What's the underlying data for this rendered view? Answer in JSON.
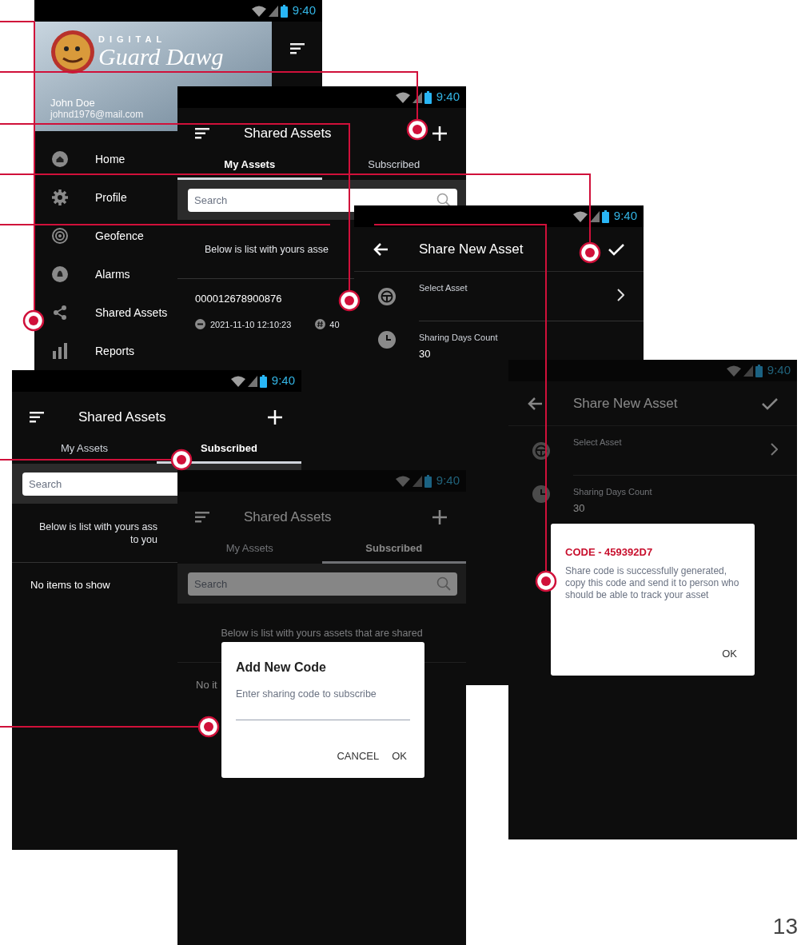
{
  "screens": [
    {
      "kind": "drawer",
      "dimmed": false,
      "time": "9:40",
      "logo_top": "DIGITAL",
      "logo_main": "Guard Dawg",
      "user_name": "John Doe",
      "user_email": "johnd1976@mail.com",
      "menu": [
        {
          "label": "Home"
        },
        {
          "label": "Profile"
        },
        {
          "label": "Geofence"
        },
        {
          "label": "Alarms"
        },
        {
          "label": "Shared Assets"
        },
        {
          "label": "Reports"
        }
      ]
    },
    {
      "kind": "list",
      "dimmed": false,
      "time": "9:40",
      "title": "Shared Assets",
      "tabs": [
        {
          "label": "My Assets",
          "selected": true
        },
        {
          "label": "Subscribed",
          "selected": false
        }
      ],
      "search": {
        "placeholder": "Search"
      },
      "notice_lines": [
        "Below is list with yours asse"
      ],
      "items": [
        {
          "id": "000012678900876",
          "date": "2021-11-10 12:10:23",
          "count": "40"
        }
      ]
    },
    {
      "kind": "form",
      "dimmed": false,
      "time": "9:40",
      "title": "Share New Asset",
      "fields": [
        {
          "label": "Select Asset"
        },
        {
          "label": "Sharing Days Count",
          "value": "30"
        }
      ]
    },
    {
      "kind": "list",
      "dimmed": false,
      "time": "9:40",
      "title": "Shared Assets",
      "tabs": [
        {
          "label": "My Assets",
          "selected": false
        },
        {
          "label": "Subscribed",
          "selected": true
        }
      ],
      "search": {
        "placeholder": "Search"
      },
      "notice_lines": [
        "Below is list with yours ass",
        "to you"
      ],
      "empty": "No items to show"
    },
    {
      "kind": "list",
      "dimmed": true,
      "time": "9:40",
      "title": "Shared Assets",
      "tabs": [
        {
          "label": "My Assets",
          "selected": false
        },
        {
          "label": "Subscribed",
          "selected": true
        }
      ],
      "search": {
        "placeholder": "Search"
      },
      "notice_lines": [
        "Below is list with yours assets that are shared"
      ],
      "empty": "No it",
      "dialog": {
        "kind": "input",
        "title": "Add New Code",
        "placeholder": "Enter sharing code to subscribe",
        "buttons": [
          "CANCEL",
          "OK"
        ]
      }
    },
    {
      "kind": "form",
      "dimmed": true,
      "time": "9:40",
      "title": "Share New Asset",
      "fields": [
        {
          "label": "Select Asset"
        },
        {
          "label": "Sharing Days Count",
          "value": "30"
        }
      ],
      "dialog": {
        "kind": "message",
        "title": "CODE - 459392D7",
        "message": "Share code is successfully generated, copy this code and send it to person who should be able to track your asset",
        "buttons": [
          "OK"
        ]
      }
    }
  ],
  "page_number": "13"
}
